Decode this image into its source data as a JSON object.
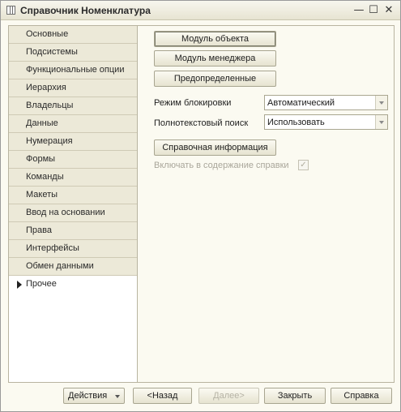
{
  "window": {
    "title": "Справочник Номенклатура",
    "minimize": "—",
    "maximize": "☐",
    "close": "✕"
  },
  "sidebar": {
    "items": [
      {
        "label": "Основные"
      },
      {
        "label": "Подсистемы"
      },
      {
        "label": "Функциональные опции"
      },
      {
        "label": "Иерархия"
      },
      {
        "label": "Владельцы"
      },
      {
        "label": "Данные"
      },
      {
        "label": "Нумерация"
      },
      {
        "label": "Формы"
      },
      {
        "label": "Команды"
      },
      {
        "label": "Макеты"
      },
      {
        "label": "Ввод на основании"
      },
      {
        "label": "Права"
      },
      {
        "label": "Интерфейсы"
      },
      {
        "label": "Обмен данными"
      },
      {
        "label": "Прочее"
      }
    ],
    "selected": "Прочее"
  },
  "main": {
    "object_module_button": "Модуль объекта",
    "manager_module_button": "Модуль менеджера",
    "predefined_button": "Предопределенные",
    "lock_mode": {
      "label": "Режим блокировки",
      "value": "Автоматический"
    },
    "fulltext_search": {
      "label": "Полнотекстовый поиск",
      "value": "Использовать"
    },
    "help_button": "Справочная информация",
    "include_in_help": {
      "label": "Включать в содержание справки",
      "checked": true
    }
  },
  "footer": {
    "actions": "Действия",
    "back": "<Назад",
    "next": "Далее>",
    "close": "Закрыть",
    "help": "Справка"
  }
}
